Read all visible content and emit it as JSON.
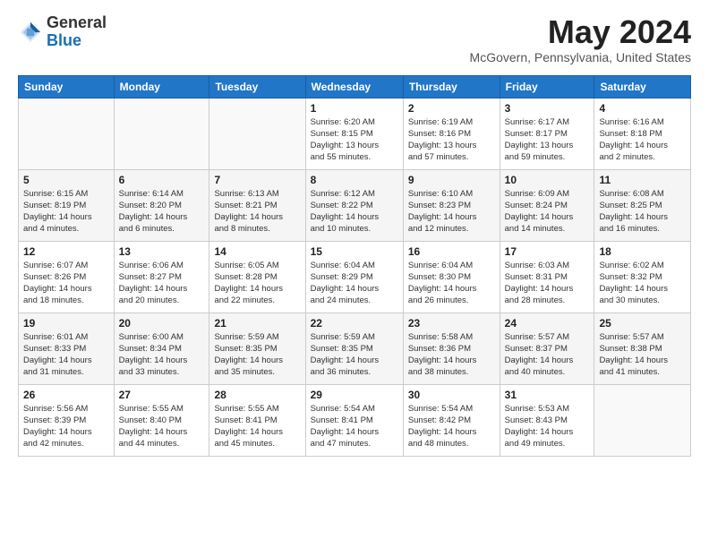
{
  "header": {
    "logo": {
      "general": "General",
      "blue": "Blue"
    },
    "month_year": "May 2024",
    "location": "McGovern, Pennsylvania, United States"
  },
  "calendar": {
    "weekdays": [
      "Sunday",
      "Monday",
      "Tuesday",
      "Wednesday",
      "Thursday",
      "Friday",
      "Saturday"
    ],
    "weeks": [
      [
        {
          "day": "",
          "info": ""
        },
        {
          "day": "",
          "info": ""
        },
        {
          "day": "",
          "info": ""
        },
        {
          "day": "1",
          "info": "Sunrise: 6:20 AM\nSunset: 8:15 PM\nDaylight: 13 hours\nand 55 minutes."
        },
        {
          "day": "2",
          "info": "Sunrise: 6:19 AM\nSunset: 8:16 PM\nDaylight: 13 hours\nand 57 minutes."
        },
        {
          "day": "3",
          "info": "Sunrise: 6:17 AM\nSunset: 8:17 PM\nDaylight: 13 hours\nand 59 minutes."
        },
        {
          "day": "4",
          "info": "Sunrise: 6:16 AM\nSunset: 8:18 PM\nDaylight: 14 hours\nand 2 minutes."
        }
      ],
      [
        {
          "day": "5",
          "info": "Sunrise: 6:15 AM\nSunset: 8:19 PM\nDaylight: 14 hours\nand 4 minutes."
        },
        {
          "day": "6",
          "info": "Sunrise: 6:14 AM\nSunset: 8:20 PM\nDaylight: 14 hours\nand 6 minutes."
        },
        {
          "day": "7",
          "info": "Sunrise: 6:13 AM\nSunset: 8:21 PM\nDaylight: 14 hours\nand 8 minutes."
        },
        {
          "day": "8",
          "info": "Sunrise: 6:12 AM\nSunset: 8:22 PM\nDaylight: 14 hours\nand 10 minutes."
        },
        {
          "day": "9",
          "info": "Sunrise: 6:10 AM\nSunset: 8:23 PM\nDaylight: 14 hours\nand 12 minutes."
        },
        {
          "day": "10",
          "info": "Sunrise: 6:09 AM\nSunset: 8:24 PM\nDaylight: 14 hours\nand 14 minutes."
        },
        {
          "day": "11",
          "info": "Sunrise: 6:08 AM\nSunset: 8:25 PM\nDaylight: 14 hours\nand 16 minutes."
        }
      ],
      [
        {
          "day": "12",
          "info": "Sunrise: 6:07 AM\nSunset: 8:26 PM\nDaylight: 14 hours\nand 18 minutes."
        },
        {
          "day": "13",
          "info": "Sunrise: 6:06 AM\nSunset: 8:27 PM\nDaylight: 14 hours\nand 20 minutes."
        },
        {
          "day": "14",
          "info": "Sunrise: 6:05 AM\nSunset: 8:28 PM\nDaylight: 14 hours\nand 22 minutes."
        },
        {
          "day": "15",
          "info": "Sunrise: 6:04 AM\nSunset: 8:29 PM\nDaylight: 14 hours\nand 24 minutes."
        },
        {
          "day": "16",
          "info": "Sunrise: 6:04 AM\nSunset: 8:30 PM\nDaylight: 14 hours\nand 26 minutes."
        },
        {
          "day": "17",
          "info": "Sunrise: 6:03 AM\nSunset: 8:31 PM\nDaylight: 14 hours\nand 28 minutes."
        },
        {
          "day": "18",
          "info": "Sunrise: 6:02 AM\nSunset: 8:32 PM\nDaylight: 14 hours\nand 30 minutes."
        }
      ],
      [
        {
          "day": "19",
          "info": "Sunrise: 6:01 AM\nSunset: 8:33 PM\nDaylight: 14 hours\nand 31 minutes."
        },
        {
          "day": "20",
          "info": "Sunrise: 6:00 AM\nSunset: 8:34 PM\nDaylight: 14 hours\nand 33 minutes."
        },
        {
          "day": "21",
          "info": "Sunrise: 5:59 AM\nSunset: 8:35 PM\nDaylight: 14 hours\nand 35 minutes."
        },
        {
          "day": "22",
          "info": "Sunrise: 5:59 AM\nSunset: 8:35 PM\nDaylight: 14 hours\nand 36 minutes."
        },
        {
          "day": "23",
          "info": "Sunrise: 5:58 AM\nSunset: 8:36 PM\nDaylight: 14 hours\nand 38 minutes."
        },
        {
          "day": "24",
          "info": "Sunrise: 5:57 AM\nSunset: 8:37 PM\nDaylight: 14 hours\nand 40 minutes."
        },
        {
          "day": "25",
          "info": "Sunrise: 5:57 AM\nSunset: 8:38 PM\nDaylight: 14 hours\nand 41 minutes."
        }
      ],
      [
        {
          "day": "26",
          "info": "Sunrise: 5:56 AM\nSunset: 8:39 PM\nDaylight: 14 hours\nand 42 minutes."
        },
        {
          "day": "27",
          "info": "Sunrise: 5:55 AM\nSunset: 8:40 PM\nDaylight: 14 hours\nand 44 minutes."
        },
        {
          "day": "28",
          "info": "Sunrise: 5:55 AM\nSunset: 8:41 PM\nDaylight: 14 hours\nand 45 minutes."
        },
        {
          "day": "29",
          "info": "Sunrise: 5:54 AM\nSunset: 8:41 PM\nDaylight: 14 hours\nand 47 minutes."
        },
        {
          "day": "30",
          "info": "Sunrise: 5:54 AM\nSunset: 8:42 PM\nDaylight: 14 hours\nand 48 minutes."
        },
        {
          "day": "31",
          "info": "Sunrise: 5:53 AM\nSunset: 8:43 PM\nDaylight: 14 hours\nand 49 minutes."
        },
        {
          "day": "",
          "info": ""
        }
      ]
    ]
  }
}
